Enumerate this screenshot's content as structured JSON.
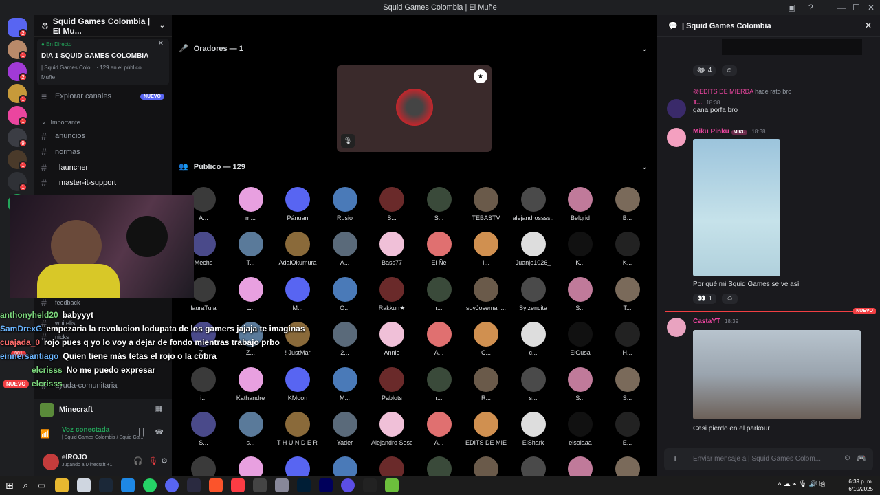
{
  "window": {
    "title": "Squid Games Colombia | El Muñe"
  },
  "sidebar": {
    "server_name": "Squid Games Colombia | El Mu...",
    "live": {
      "tag": "En Directo",
      "title": "DÍA 1 SQUID GAMES COLOMBIA",
      "sub": "| Squid Games Colo...",
      "viewers": "129 en el público",
      "host": "Muñe"
    },
    "explore": "Explorar canales",
    "explore_badge": "NUEVO",
    "category": "Importante",
    "channels": [
      "anuncios",
      "normas",
      "| launcher",
      "| master-it-support"
    ],
    "lower": [
      "feedback",
      "whitelist",
      "nicks",
      "ayuda-comunitaria"
    ],
    "new_badge": "NUEVO",
    "server_badges": [
      "2",
      "1",
      "2",
      "1",
      "1",
      "9",
      "1",
      "1",
      "99+",
      "881"
    ],
    "game": "Minecraft",
    "voice": {
      "status": "Voz conectada",
      "channel": "| Squid Games Colombia / Squid Ga..."
    },
    "user": {
      "name": "elROJO",
      "activity": "Jugando a Minecraft +1"
    }
  },
  "stage": {
    "speakers_label": "Oradores — 1",
    "audience_label": "Público — 129",
    "audience": [
      "A...",
      "m...",
      "Pánuan",
      "Rusio",
      "S...",
      "S...",
      "TEBASTV",
      "alejandrossss...",
      "Belgrid",
      "B...",
      "Mechs",
      "T...",
      "AdalOkumura",
      "A...",
      "Bass77",
      "El Ñe",
      "I...",
      "Juanjo1026_",
      "K...",
      "K...",
      "lauraTula",
      "L...",
      "M...",
      "O...",
      "Rakkun★",
      "r...",
      "soyJosema_...",
      "Sylzencita",
      "S...",
      "T...",
      "Z...",
      "Z...",
      "! JustMar",
      "2...",
      "Annie",
      "A...",
      "C...",
      "c...",
      "ElGusa",
      "H...",
      "i...",
      "Kathandre",
      "KMoon",
      "M...",
      "Pablots",
      "r...",
      "R...",
      "s...",
      "S...",
      "S...",
      "S...",
      "s...",
      "T H U N D E R...",
      "Yader",
      "Alejandro Sosa",
      "A...",
      "EDITS DE MIE...",
      "ElShark",
      "elsolaaa",
      "E...",
      "",
      "",
      "",
      "",
      "",
      "",
      "",
      "",
      "",
      ""
    ]
  },
  "overlay_chat": [
    {
      "user": "anthonyheld20",
      "text": "babyyyt"
    },
    {
      "user": "SamDrexG",
      "text": "empezaria la revolucion lodupata de los gamers jajaja te imaginas"
    },
    {
      "user": "cuajada_0",
      "text": "rojo pues q yo lo voy a dejar de fondo mientras trabajo prbo"
    },
    {
      "user": "einnersantiago",
      "text": "Quien tiene más tetas el rojo o la cobra"
    },
    {
      "user": "elcrisss",
      "text": "No me puedo expresar"
    },
    {
      "user": "elcrisss",
      "text": "..."
    }
  ],
  "right": {
    "title": "| Squid Games Colombia",
    "reaction1": {
      "count": "4"
    },
    "reply_to": "@EDITS DE MIERDA",
    "reply_text": "hace rato bro",
    "m1": {
      "author": "T...",
      "time": "18:38",
      "text": "gana porfa bro"
    },
    "m2": {
      "author": "Miku Pinku",
      "tag": "MIKU",
      "time": "18:38",
      "text": "Por qué mi Squid Games se ve así",
      "reaction": "1"
    },
    "new_label": "NUEVO",
    "m3": {
      "author": "CastaYT",
      "time": "18:39",
      "text": "Casi pierdo en el parkour"
    },
    "composer": "Enviar mensaje a | Squid Games Colom..."
  },
  "taskbar": {
    "time": "6:39 p. m.",
    "date": "6/10/2025"
  },
  "colors": {
    "accent": "#5865f2",
    "danger": "#f23f43",
    "online": "#23a55a",
    "pink": "#eb459f"
  }
}
